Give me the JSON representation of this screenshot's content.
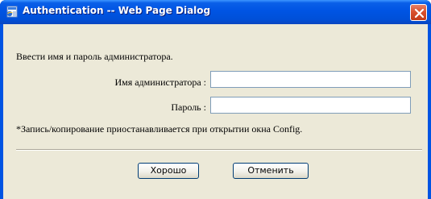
{
  "window": {
    "title": "Authentication -- Web Page Dialog",
    "app_icon": "ie-page-icon",
    "close_icon": "close-icon"
  },
  "dialog": {
    "instruction": "Ввести имя и пароль администратора.",
    "fields": {
      "admin_name_label": "Имя администратора :",
      "admin_name_value": "",
      "password_label": "Пароль :",
      "password_value": ""
    },
    "note": "*Запись/копирование приостанавливается при открытии окна Config.",
    "buttons": {
      "ok_label": "Хорошо",
      "cancel_label": "Отменить"
    }
  },
  "colors": {
    "titlebar": "#0054e3",
    "client_bg": "#ece9d8",
    "close_button": "#d9502e",
    "input_border": "#7f9db9",
    "button_border": "#003c74"
  }
}
